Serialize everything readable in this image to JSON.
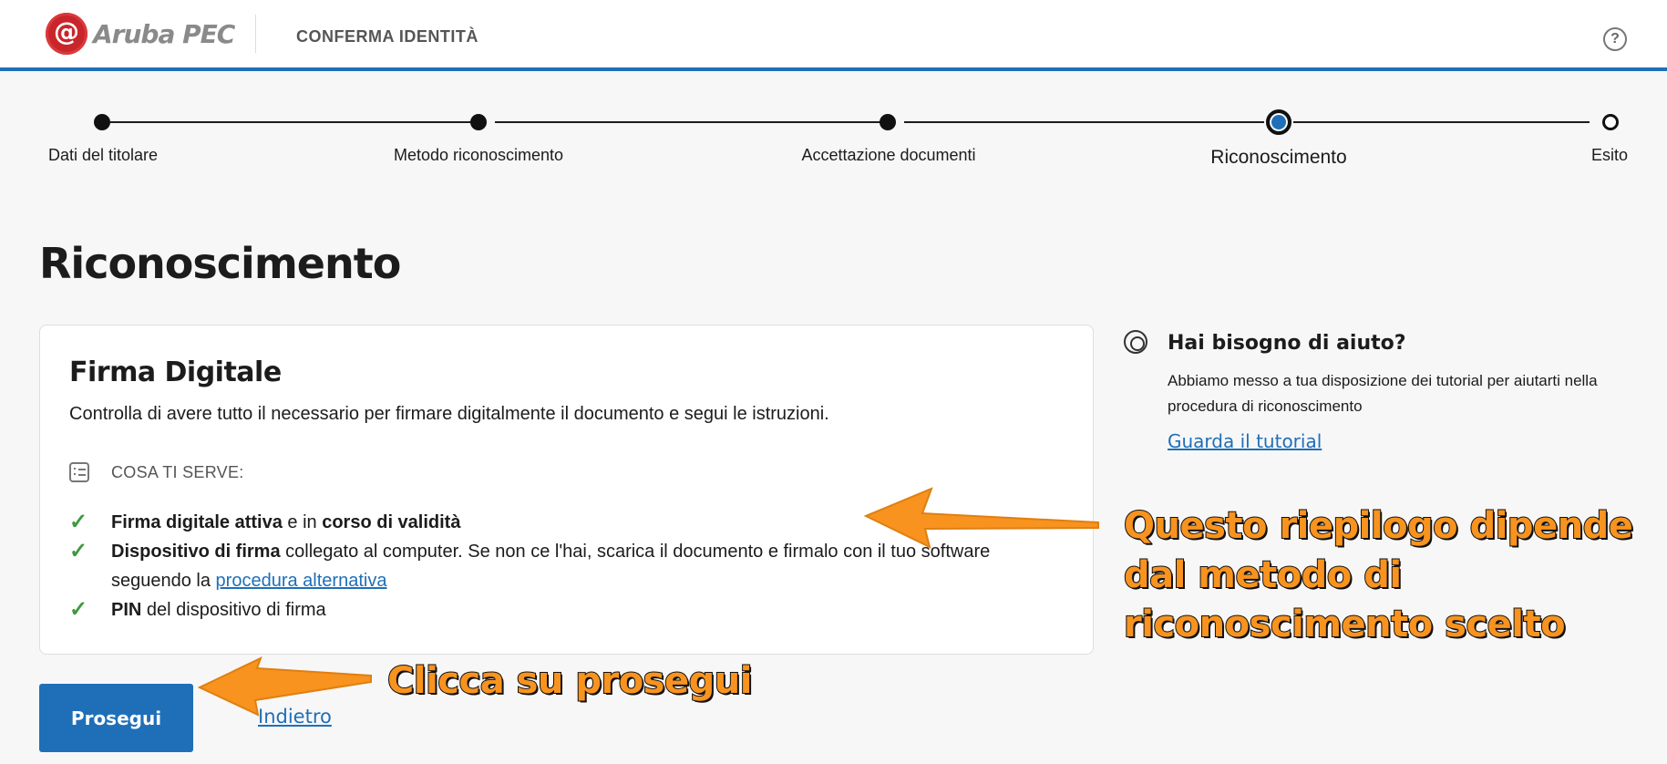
{
  "header": {
    "logo_text": "Aruba PEC",
    "logo_mark": "@",
    "title": "CONFERMA IDENTITÀ",
    "help_icon": "?"
  },
  "stepper": {
    "steps": [
      {
        "label": "Dati del titolare",
        "state": "done"
      },
      {
        "label": "Metodo riconoscimento",
        "state": "done"
      },
      {
        "label": "Accettazione documenti",
        "state": "done"
      },
      {
        "label": "Riconoscimento",
        "state": "current"
      },
      {
        "label": "Esito",
        "state": "todo"
      }
    ]
  },
  "page": {
    "title": "Riconoscimento"
  },
  "card": {
    "title": "Firma Digitale",
    "description": "Controlla di avere tutto il necessario per firmare digitalmente il documento e segui le istruzioni.",
    "needs_label": "COSA TI SERVE:",
    "requirements": {
      "r1_bold_a": "Firma digitale attiva",
      "r1_text_a": " e in ",
      "r1_bold_b": "corso di validità",
      "r2_bold": "Dispositivo di firma",
      "r2_text": " collegato al computer. Se non ce l'hai, scarica il documento e firmalo con il tuo software seguendo la ",
      "r2_link": "procedura alternativa",
      "r3_bold": "PIN",
      "r3_text": " del dispositivo di firma"
    }
  },
  "actions": {
    "continue_label": "Prosegui",
    "back_label": "Indietro"
  },
  "help": {
    "title": "Hai bisogno di aiuto?",
    "text": "Abbiamo messo a tua disposizione dei tutorial per aiutarti nella procedura di riconoscimento",
    "link": "Guarda il tutorial"
  },
  "annotations": {
    "summary_note": "Questo riepilogo dipende dal metodo di riconoscimento scelto",
    "continue_note": "Clicca su prosegui"
  },
  "colors": {
    "accent": "#1f6fb8",
    "check": "#3f9a3f",
    "annotation": "#f7931e"
  }
}
